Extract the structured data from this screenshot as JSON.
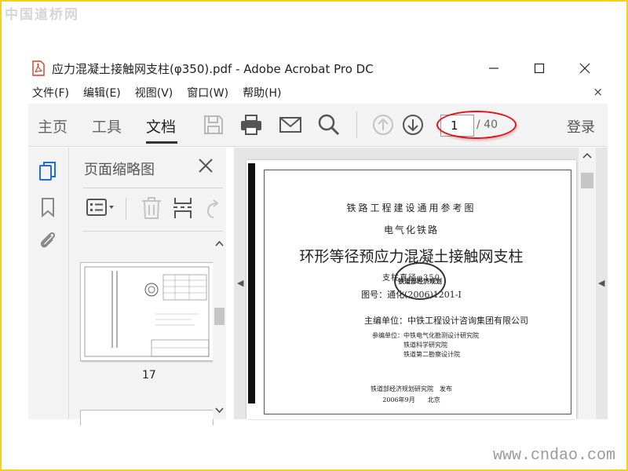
{
  "watermarks": {
    "top_left": "中国道桥网",
    "bottom_right": "www.cndao.com"
  },
  "window": {
    "title": "应力混凝土接触网支柱(φ350).pdf - Adobe Acrobat Pro DC",
    "minimize": "—",
    "maximize": "☐",
    "close": "✕"
  },
  "menu": {
    "items": [
      "文件(F)",
      "编辑(E)",
      "视图(V)",
      "窗口(W)",
      "帮助(H)"
    ],
    "close": "×"
  },
  "toolbar": {
    "tabs": [
      "主页",
      "工具",
      "文档"
    ],
    "active_tab": "文档",
    "current_page": "1",
    "page_total": "/ 40",
    "signin": "登录",
    "icons": [
      "save-icon",
      "print-icon",
      "email-icon",
      "search-icon",
      "page-up-icon",
      "page-down-icon"
    ]
  },
  "thumbnails": {
    "title": "页面缩略图",
    "page_label": "17"
  },
  "document": {
    "line1": "铁路工程建设通用参考图",
    "line2": "电气化铁路",
    "line3": "环形等径预应力混凝土接触网支柱",
    "line4": "支柱直径φ350",
    "line5": "图号：通化(2006)1201-Ⅰ",
    "stamp": "铁道部经济规划研究院",
    "line6": "主编单位：中铁工程设计咨询集团有限公司",
    "line7": "参编单位：中铁电气化勘测设计研究院",
    "line8": "铁道科学研究院",
    "line9": "铁道第二勘察设计院",
    "line10": "",
    "line11": "铁道部经济规划研究院　发布",
    "line12": "2006年9月　　北京"
  },
  "colors": {
    "highlight": "#e3141b",
    "border": "#f5d21a",
    "toolbar_bg": "#f3f3f3",
    "pdf_red": "#d83b2b"
  }
}
